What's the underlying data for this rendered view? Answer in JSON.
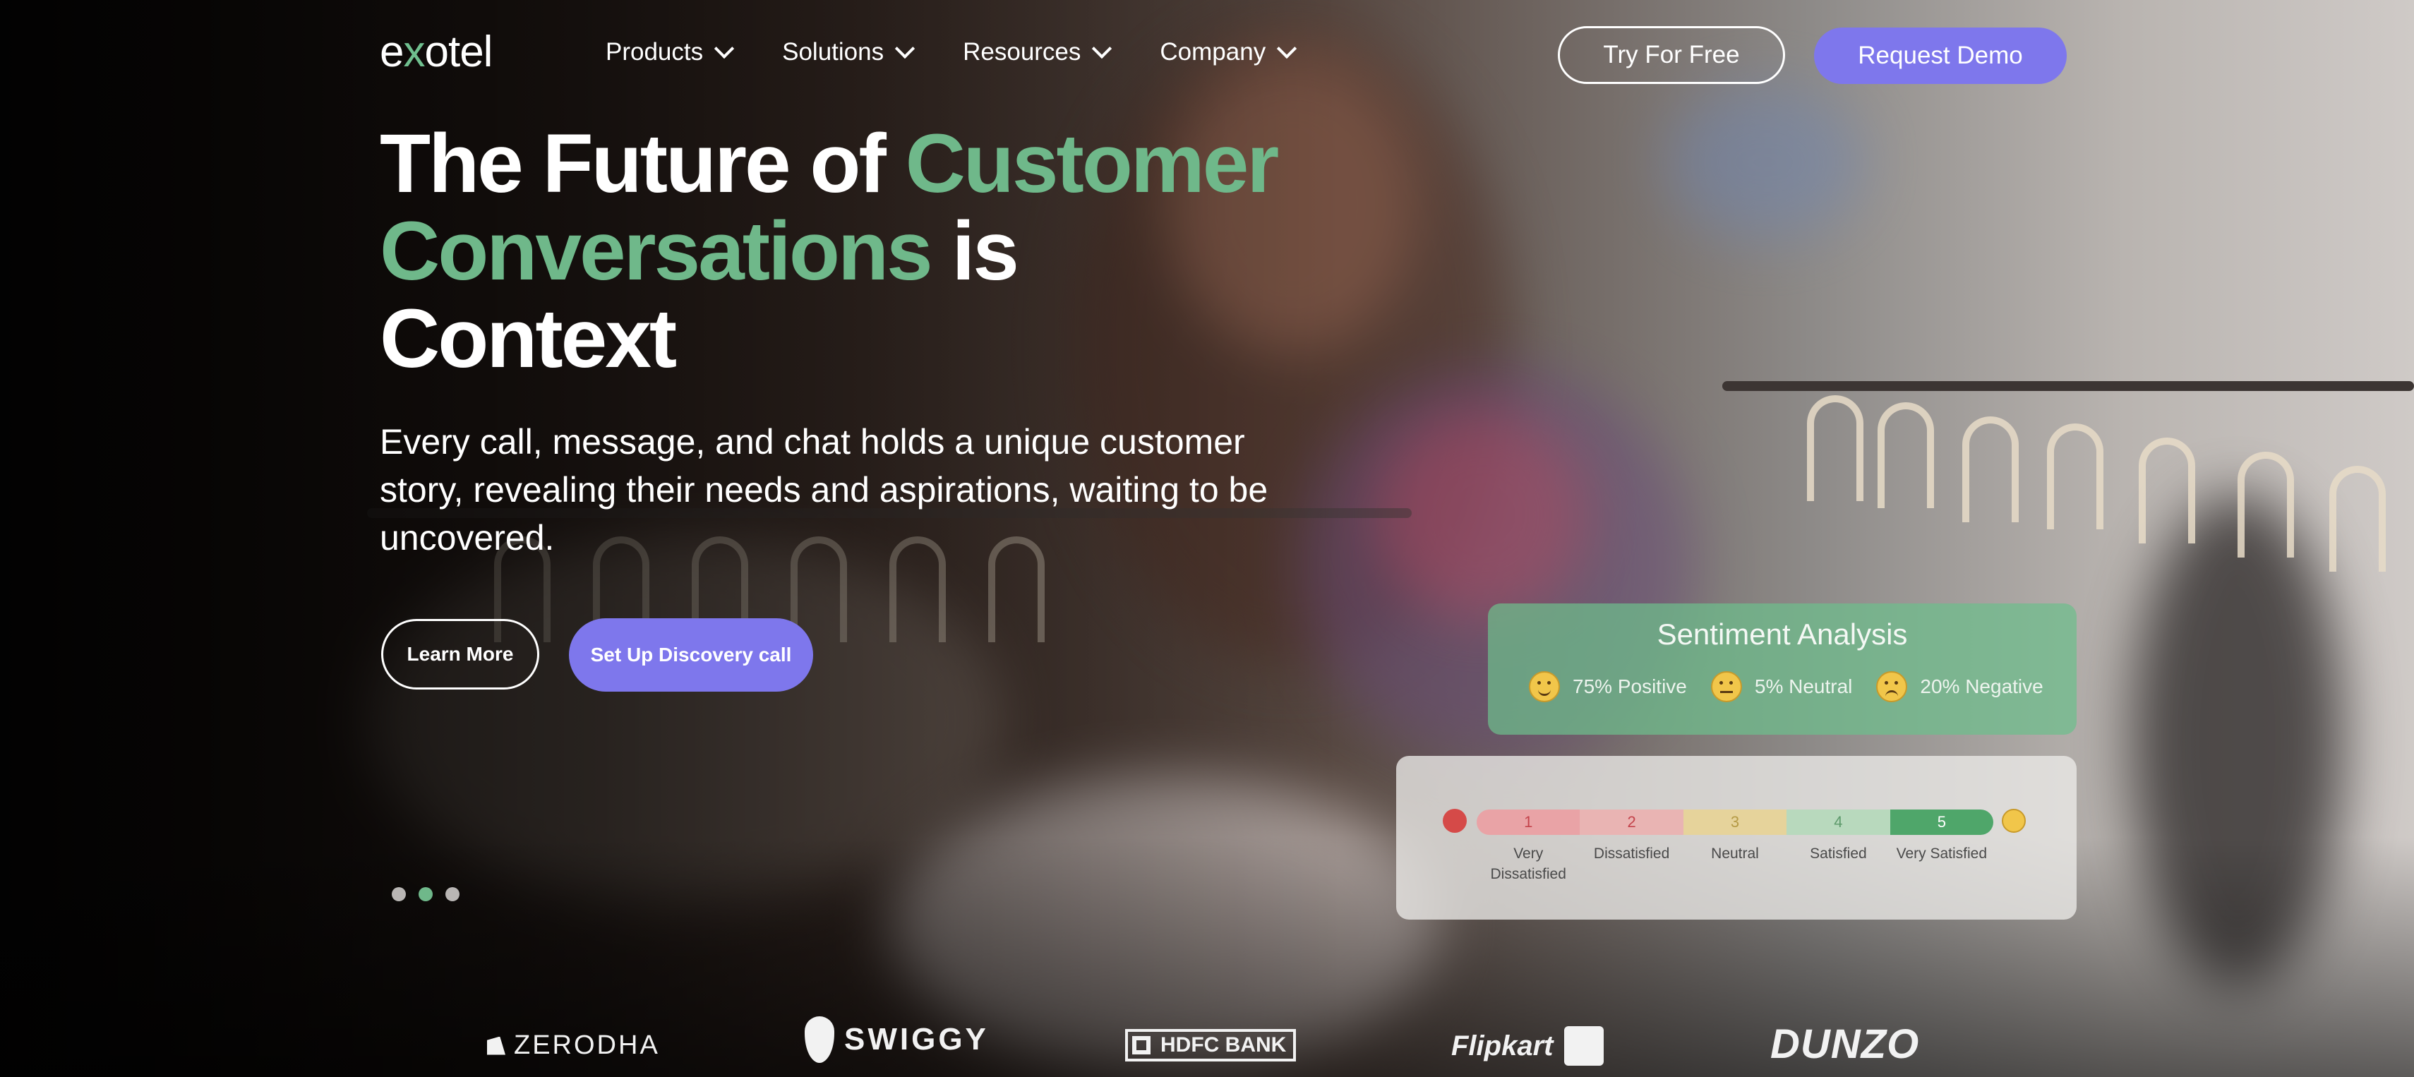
{
  "brand": {
    "logo_prefix": "e",
    "logo_x": "x",
    "logo_suffix": "otel"
  },
  "nav": {
    "items": [
      {
        "label": "Products"
      },
      {
        "label": "Solutions"
      },
      {
        "label": "Resources"
      },
      {
        "label": "Company"
      }
    ],
    "try_label": "Try For Free",
    "demo_label": "Request Demo"
  },
  "hero": {
    "headline_part1": "The Future of ",
    "headline_highlight": "Customer Conversations",
    "headline_part2": " is Context",
    "subtext": "Every call, message, and chat holds a unique customer story, revealing their needs and aspirations, waiting to be uncovered.",
    "learn_label": "Learn More",
    "discovery_label": "Set Up Discovery call",
    "slides_total": 3,
    "slide_active": 2
  },
  "sentiment": {
    "title": "Sentiment Analysis",
    "positive": "75% Positive",
    "neutral": "5% Neutral",
    "negative": "20% Negative"
  },
  "rating": {
    "numbers": [
      "1",
      "2",
      "3",
      "4",
      "5"
    ],
    "labels": [
      "Very Dissatisfied",
      "Dissatisfied",
      "Neutral",
      "Satisfied",
      "Very Satisfied"
    ],
    "colors": [
      "#e9a3a6",
      "#e9b4b3",
      "#e6d39b",
      "#b8d9bd",
      "#4fa66a"
    ]
  },
  "logos": {
    "zerodha": "ZERODHA",
    "swiggy": "SWIGGY",
    "hdfc": "HDFC BANK",
    "flipkart": "Flipkart",
    "dunzo": "DUNZO"
  }
}
